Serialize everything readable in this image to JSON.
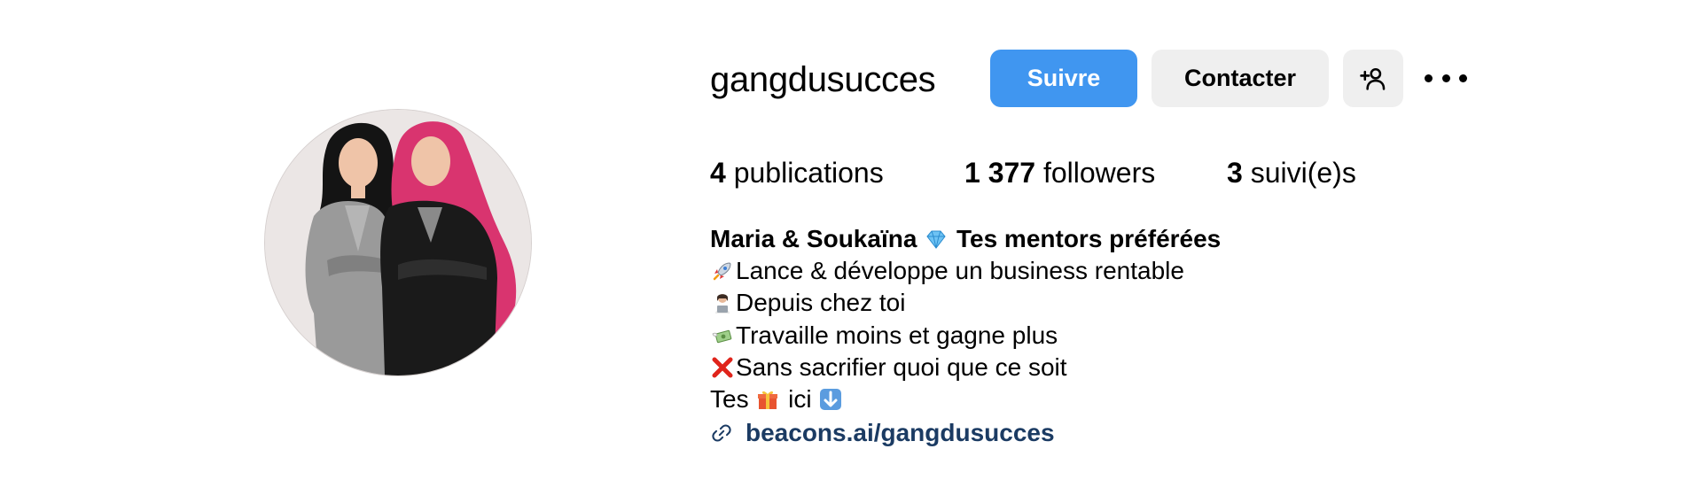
{
  "profile": {
    "username": "gangdusucces",
    "follow_label": "Suivre",
    "contact_label": "Contacter",
    "add_user_icon": "person-plus-icon",
    "more_icon": "more-options-icon",
    "avatar_icon": "profile-avatar",
    "accent_color": "#4096f0"
  },
  "stats": {
    "posts_count": "4",
    "posts_label": "publications",
    "followers_count": "1 377",
    "followers_label": "followers",
    "following_count": "3",
    "following_label": "suivi(e)s"
  },
  "bio": {
    "name": "Maria & Soukaïna",
    "name_emoji": "gem-icon",
    "tagline": "Tes mentors préférées",
    "lines": [
      {
        "emoji": "rocket-icon",
        "text": "Lance & développe un business rentable"
      },
      {
        "emoji": "woman-laptop-icon",
        "text": "Depuis chez toi"
      },
      {
        "emoji": "money-wings-icon",
        "text": "Travaille moins et gagne plus"
      },
      {
        "emoji": "red-cross-icon",
        "text": "Sans sacrifier quoi que ce soit"
      }
    ],
    "gift_prefix": "Tes",
    "gift_suffix": "ici",
    "gift_emoji": "gift-icon",
    "arrow_emoji": "down-arrow-icon",
    "link_icon": "link-icon",
    "link_text": "beacons.ai/gangdusucces"
  }
}
